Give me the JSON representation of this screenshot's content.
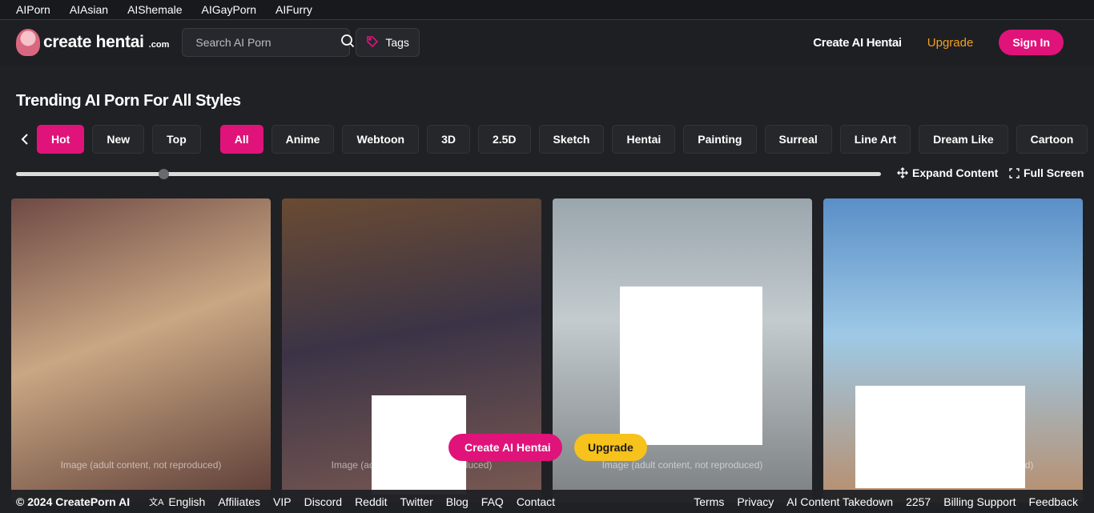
{
  "top_links": [
    "AIPorn",
    "AIAsian",
    "AIShemale",
    "AIGayPorn",
    "AIFurry"
  ],
  "header": {
    "logo_text": "create hentai",
    "logo_suffix": ".com",
    "search_placeholder": "Search AI Porn",
    "tags_label": "Tags",
    "create_label": "Create AI Hentai",
    "upgrade_label": "Upgrade",
    "signin_label": "Sign In"
  },
  "colors": {
    "accent": "#e0137a",
    "upgrade_text": "#f0a020",
    "upgrade_button": "#f6c21b",
    "background": "#202125"
  },
  "main": {
    "title": "Trending AI Porn For All Styles",
    "sort_chips": [
      {
        "label": "Hot",
        "active": true
      },
      {
        "label": "New",
        "active": false
      },
      {
        "label": "Top",
        "active": false
      }
    ],
    "style_chips": [
      {
        "label": "All",
        "active": true
      },
      {
        "label": "Anime",
        "active": false
      },
      {
        "label": "Webtoon",
        "active": false
      },
      {
        "label": "3D",
        "active": false
      },
      {
        "label": "2.5D",
        "active": false
      },
      {
        "label": "Sketch",
        "active": false
      },
      {
        "label": "Hentai",
        "active": false
      },
      {
        "label": "Painting",
        "active": false
      },
      {
        "label": "Surreal",
        "active": false
      },
      {
        "label": "Line Art",
        "active": false
      },
      {
        "label": "Dream Like",
        "active": false
      },
      {
        "label": "Cartoon",
        "active": false
      }
    ],
    "size_slider_value": 0.17,
    "expand_label": "Expand Content",
    "fullscreen_label": "Full Screen",
    "gallery_placeholder": "Image (adult content, not reproduced)",
    "gallery_count": 4
  },
  "floating": {
    "create_label": "Create AI Hentai",
    "upgrade_label": "Upgrade"
  },
  "footer": {
    "copyright": "© 2024 CreatePorn AI",
    "language": "English",
    "left_links": [
      "Affiliates",
      "VIP",
      "Discord",
      "Reddit",
      "Twitter",
      "Blog",
      "FAQ",
      "Contact"
    ],
    "right_links": [
      "Terms",
      "Privacy",
      "AI Content Takedown",
      "2257",
      "Billing Support",
      "Feedback"
    ]
  }
}
